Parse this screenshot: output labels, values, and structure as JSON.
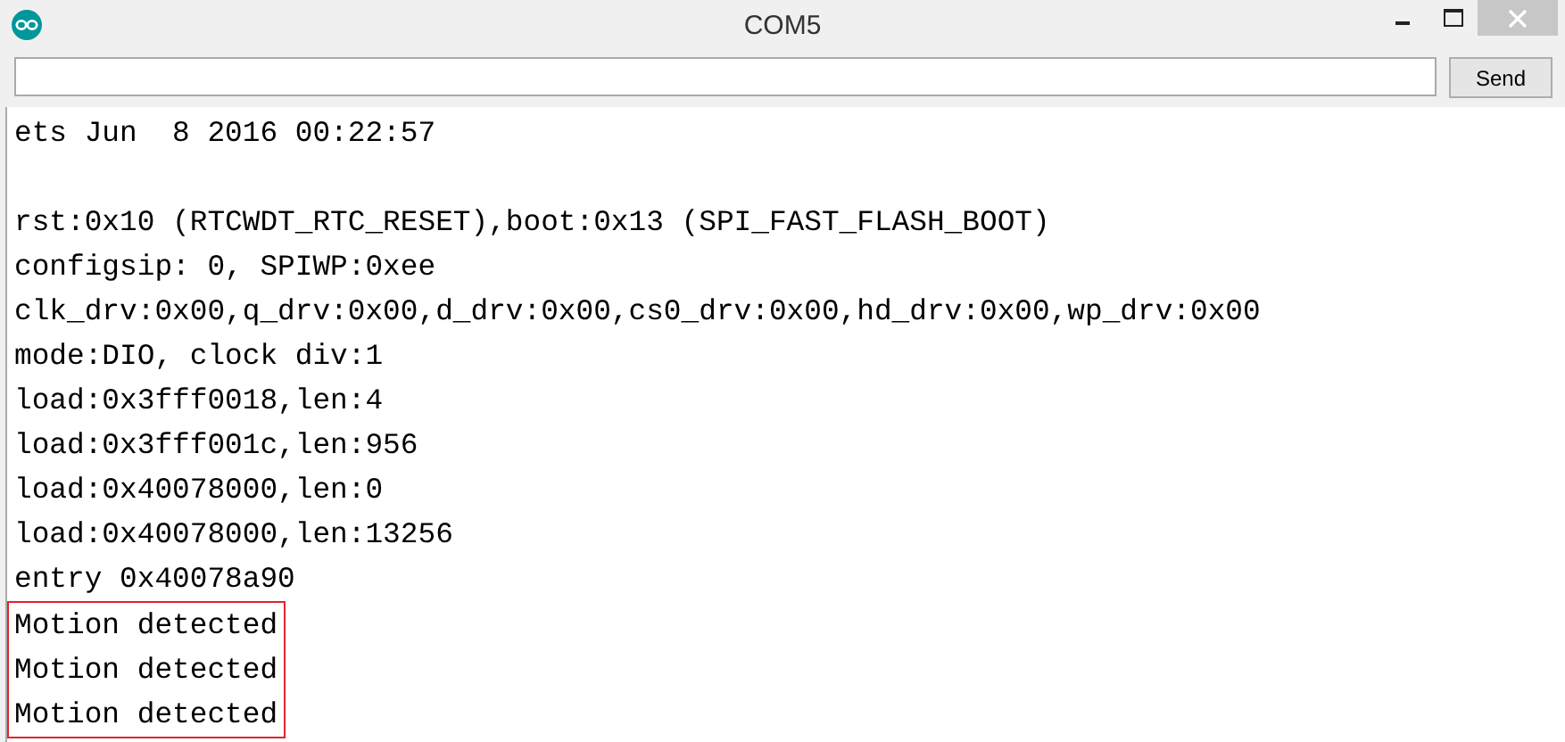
{
  "window": {
    "title": "COM5"
  },
  "send_button": {
    "label": "Send"
  },
  "output": {
    "paragraphs": [
      [
        "ets Jun  8 2016 00:22:57"
      ],
      [
        "rst:0x10 (RTCWDT_RTC_RESET),boot:0x13 (SPI_FAST_FLASH_BOOT)",
        "configsip: 0, SPIWP:0xee",
        "clk_drv:0x00,q_drv:0x00,d_drv:0x00,cs0_drv:0x00,hd_drv:0x00,wp_drv:0x00",
        "mode:DIO, clock div:1",
        "load:0x3fff0018,len:4",
        "load:0x3fff001c,len:956",
        "load:0x40078000,len:0",
        "load:0x40078000,len:13256",
        "entry 0x40078a90"
      ]
    ],
    "boxed_lines": [
      "Motion detected",
      "Motion detected",
      "Motion detected"
    ]
  }
}
